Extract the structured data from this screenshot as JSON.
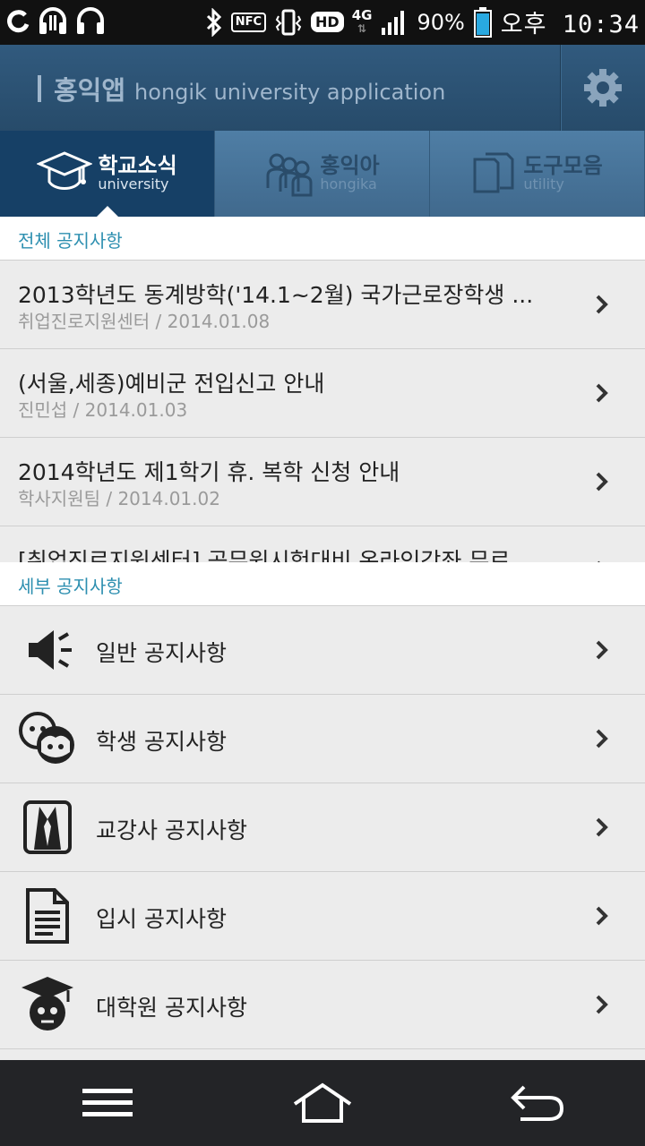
{
  "status_bar": {
    "left_icons": [
      "sync-icon",
      "headphones-icon",
      "headphones-outline-icon"
    ],
    "nfc": "NFC",
    "hd": "HD",
    "network": "4G",
    "battery": "90%",
    "time": "오후 10:34"
  },
  "header": {
    "title_ko": "홍익앱",
    "title_en": "hongik university application",
    "settings_icon": "gear-icon"
  },
  "tabs": [
    {
      "label": "학교소식",
      "sub": "university",
      "icon": "graduation-cap-icon",
      "active": true
    },
    {
      "label": "홍익아",
      "sub": "hongika",
      "icon": "people-icon",
      "active": false
    },
    {
      "label": "도구모음",
      "sub": "utility",
      "icon": "documents-icon",
      "active": false
    }
  ],
  "sections": {
    "all_notices": "전체 공지사항",
    "detail_notices": "세부 공지사항"
  },
  "notices": [
    {
      "title": "2013학년도 동계방학('14.1~2월) 국가근로장학생 ...",
      "meta": "취업진로지원센터 / 2014.01.08"
    },
    {
      "title": "(서울,세종)예비군 전입신고 안내",
      "meta": "진민섭 / 2014.01.03"
    },
    {
      "title": "2014학년도 제1학기 휴. 복학 신청 안내",
      "meta": "학사지원팀 / 2014.01.02"
    },
    {
      "title": "[취업진로지원센터] 공무원시험대비 온라인강좌 무료",
      "meta": ""
    }
  ],
  "categories": [
    {
      "label": "일반 공지사항",
      "icon": "megaphone-icon"
    },
    {
      "label": "학생 공지사항",
      "icon": "students-icon"
    },
    {
      "label": "교강사 공지사항",
      "icon": "instructor-icon"
    },
    {
      "label": "입시 공지사항",
      "icon": "document-icon"
    },
    {
      "label": "대학원 공지사항",
      "icon": "graduate-icon"
    }
  ],
  "nav_bar": {
    "menu_icon": "menu-icon",
    "home_icon": "home-icon",
    "back_icon": "back-icon"
  }
}
